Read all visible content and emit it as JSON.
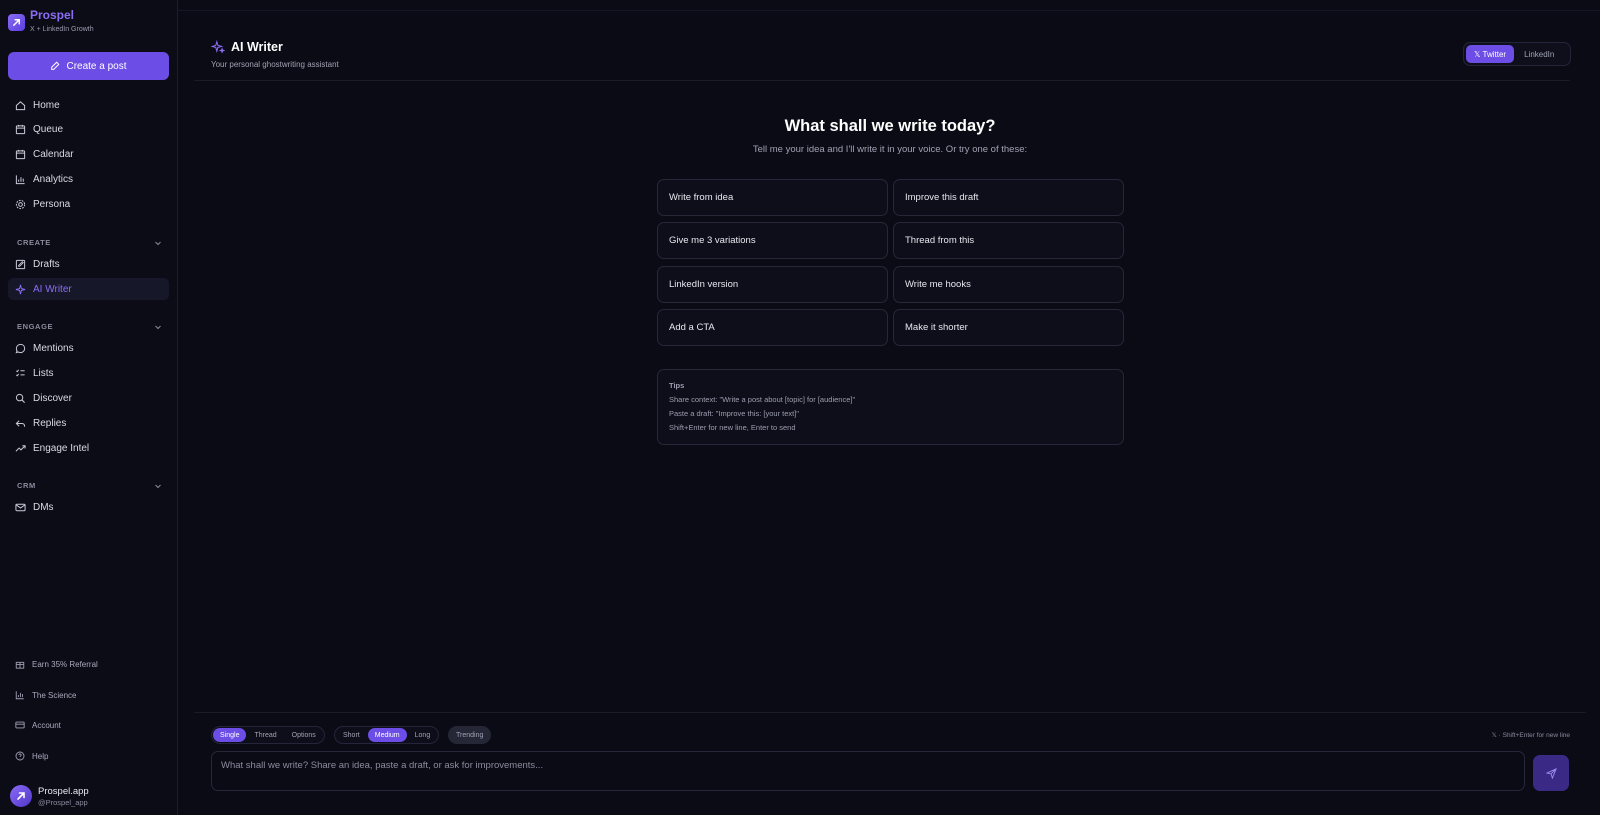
{
  "brand": {
    "name": "Prospel",
    "tagline": "X + LinkedIn Growth"
  },
  "sidebar": {
    "create_button": "Create a post",
    "main_items": [
      {
        "label": "Home",
        "icon": "home-icon"
      },
      {
        "label": "Queue",
        "icon": "queue-icon"
      },
      {
        "label": "Calendar",
        "icon": "calendar-icon"
      },
      {
        "label": "Analytics",
        "icon": "analytics-icon"
      },
      {
        "label": "Persona",
        "icon": "persona-icon"
      }
    ],
    "sections": {
      "create": {
        "label": "CREATE",
        "items": [
          {
            "label": "Drafts",
            "icon": "drafts-icon"
          },
          {
            "label": "AI Writer",
            "icon": "sparkles-icon",
            "active": true
          }
        ]
      },
      "engage": {
        "label": "ENGAGE",
        "items": [
          {
            "label": "Mentions",
            "icon": "mentions-icon"
          },
          {
            "label": "Lists",
            "icon": "lists-icon"
          },
          {
            "label": "Discover",
            "icon": "search-icon"
          },
          {
            "label": "Replies",
            "icon": "reply-icon"
          },
          {
            "label": "Engage Intel",
            "icon": "trend-icon"
          }
        ]
      },
      "crm": {
        "label": "CRM",
        "items": [
          {
            "label": "DMs",
            "icon": "mail-icon"
          }
        ]
      }
    },
    "footer": [
      {
        "label": "Earn 35% Referral",
        "icon": "gift-icon"
      },
      {
        "label": "The Science",
        "icon": "chart-icon"
      },
      {
        "label": "Account",
        "icon": "card-icon"
      },
      {
        "label": "Help",
        "icon": "help-icon"
      }
    ],
    "profile": {
      "name": "Prospel.app",
      "handle": "@Prospel_app"
    }
  },
  "header": {
    "title": "AI Writer",
    "subtitle": "Your personal ghostwriting assistant",
    "platforms": [
      "𝕏 Twitter",
      "LinkedIn"
    ],
    "active_platform": "𝕏 Twitter"
  },
  "hero": {
    "title": "What shall we write today?",
    "subtitle": "Tell me your idea and I'll write it in your voice. Or try one of these:"
  },
  "suggestions": [
    "Write from idea",
    "Improve this draft",
    "Give me 3 variations",
    "Thread from this",
    "LinkedIn version",
    "Write me hooks",
    "Add a CTA",
    "Make it shorter"
  ],
  "tips": {
    "title": "Tips",
    "lines": [
      "Share context: \"Write a post about [topic] for [audience]\"",
      "Paste a draft: \"Improve this: [your text]\"",
      "Shift+Enter for new line, Enter to send"
    ]
  },
  "composer": {
    "format_options": [
      "Single",
      "Thread",
      "Options"
    ],
    "format_selected": "Single",
    "length_options": [
      "Short",
      "Medium",
      "Long"
    ],
    "length_selected": "Medium",
    "trending_label": "Trending",
    "hint": "𝕏 · Shift+Enter for new line",
    "placeholder": "What shall we write? Share an idea, paste a draft, or ask for improvements..."
  },
  "colors": {
    "accent": "#6c4ee6",
    "accent_text": "#8b6cf6",
    "background": "#0a0b14"
  }
}
